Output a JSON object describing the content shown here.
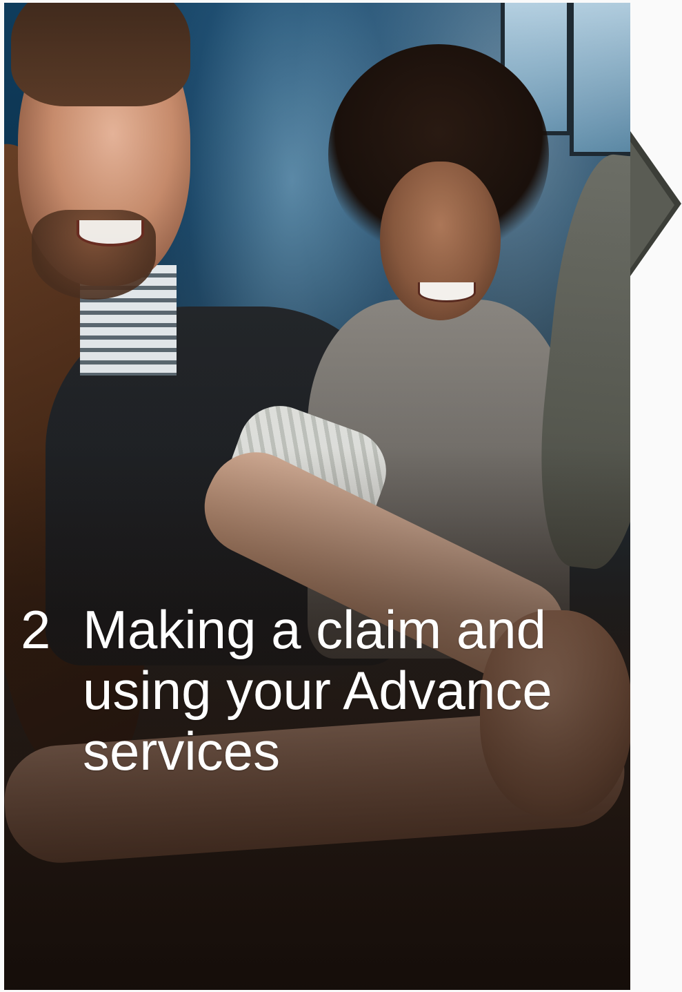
{
  "section": {
    "number": "2",
    "title": "Making a claim and\nusing your Advance\nservices"
  },
  "photo": {
    "description_icon": "team-hands-photo"
  }
}
